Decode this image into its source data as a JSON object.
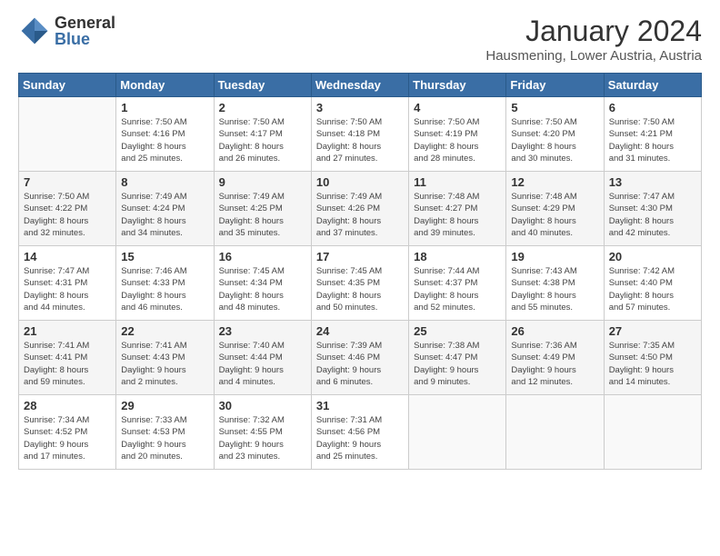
{
  "logo": {
    "general": "General",
    "blue": "Blue"
  },
  "title": "January 2024",
  "subtitle": "Hausmening, Lower Austria, Austria",
  "days_header": [
    "Sunday",
    "Monday",
    "Tuesday",
    "Wednesday",
    "Thursday",
    "Friday",
    "Saturday"
  ],
  "weeks": [
    [
      {
        "day": "",
        "info": ""
      },
      {
        "day": "1",
        "info": "Sunrise: 7:50 AM\nSunset: 4:16 PM\nDaylight: 8 hours\nand 25 minutes."
      },
      {
        "day": "2",
        "info": "Sunrise: 7:50 AM\nSunset: 4:17 PM\nDaylight: 8 hours\nand 26 minutes."
      },
      {
        "day": "3",
        "info": "Sunrise: 7:50 AM\nSunset: 4:18 PM\nDaylight: 8 hours\nand 27 minutes."
      },
      {
        "day": "4",
        "info": "Sunrise: 7:50 AM\nSunset: 4:19 PM\nDaylight: 8 hours\nand 28 minutes."
      },
      {
        "day": "5",
        "info": "Sunrise: 7:50 AM\nSunset: 4:20 PM\nDaylight: 8 hours\nand 30 minutes."
      },
      {
        "day": "6",
        "info": "Sunrise: 7:50 AM\nSunset: 4:21 PM\nDaylight: 8 hours\nand 31 minutes."
      }
    ],
    [
      {
        "day": "7",
        "info": "Sunrise: 7:50 AM\nSunset: 4:22 PM\nDaylight: 8 hours\nand 32 minutes."
      },
      {
        "day": "8",
        "info": "Sunrise: 7:49 AM\nSunset: 4:24 PM\nDaylight: 8 hours\nand 34 minutes."
      },
      {
        "day": "9",
        "info": "Sunrise: 7:49 AM\nSunset: 4:25 PM\nDaylight: 8 hours\nand 35 minutes."
      },
      {
        "day": "10",
        "info": "Sunrise: 7:49 AM\nSunset: 4:26 PM\nDaylight: 8 hours\nand 37 minutes."
      },
      {
        "day": "11",
        "info": "Sunrise: 7:48 AM\nSunset: 4:27 PM\nDaylight: 8 hours\nand 39 minutes."
      },
      {
        "day": "12",
        "info": "Sunrise: 7:48 AM\nSunset: 4:29 PM\nDaylight: 8 hours\nand 40 minutes."
      },
      {
        "day": "13",
        "info": "Sunrise: 7:47 AM\nSunset: 4:30 PM\nDaylight: 8 hours\nand 42 minutes."
      }
    ],
    [
      {
        "day": "14",
        "info": "Sunrise: 7:47 AM\nSunset: 4:31 PM\nDaylight: 8 hours\nand 44 minutes."
      },
      {
        "day": "15",
        "info": "Sunrise: 7:46 AM\nSunset: 4:33 PM\nDaylight: 8 hours\nand 46 minutes."
      },
      {
        "day": "16",
        "info": "Sunrise: 7:45 AM\nSunset: 4:34 PM\nDaylight: 8 hours\nand 48 minutes."
      },
      {
        "day": "17",
        "info": "Sunrise: 7:45 AM\nSunset: 4:35 PM\nDaylight: 8 hours\nand 50 minutes."
      },
      {
        "day": "18",
        "info": "Sunrise: 7:44 AM\nSunset: 4:37 PM\nDaylight: 8 hours\nand 52 minutes."
      },
      {
        "day": "19",
        "info": "Sunrise: 7:43 AM\nSunset: 4:38 PM\nDaylight: 8 hours\nand 55 minutes."
      },
      {
        "day": "20",
        "info": "Sunrise: 7:42 AM\nSunset: 4:40 PM\nDaylight: 8 hours\nand 57 minutes."
      }
    ],
    [
      {
        "day": "21",
        "info": "Sunrise: 7:41 AM\nSunset: 4:41 PM\nDaylight: 8 hours\nand 59 minutes."
      },
      {
        "day": "22",
        "info": "Sunrise: 7:41 AM\nSunset: 4:43 PM\nDaylight: 9 hours\nand 2 minutes."
      },
      {
        "day": "23",
        "info": "Sunrise: 7:40 AM\nSunset: 4:44 PM\nDaylight: 9 hours\nand 4 minutes."
      },
      {
        "day": "24",
        "info": "Sunrise: 7:39 AM\nSunset: 4:46 PM\nDaylight: 9 hours\nand 6 minutes."
      },
      {
        "day": "25",
        "info": "Sunrise: 7:38 AM\nSunset: 4:47 PM\nDaylight: 9 hours\nand 9 minutes."
      },
      {
        "day": "26",
        "info": "Sunrise: 7:36 AM\nSunset: 4:49 PM\nDaylight: 9 hours\nand 12 minutes."
      },
      {
        "day": "27",
        "info": "Sunrise: 7:35 AM\nSunset: 4:50 PM\nDaylight: 9 hours\nand 14 minutes."
      }
    ],
    [
      {
        "day": "28",
        "info": "Sunrise: 7:34 AM\nSunset: 4:52 PM\nDaylight: 9 hours\nand 17 minutes."
      },
      {
        "day": "29",
        "info": "Sunrise: 7:33 AM\nSunset: 4:53 PM\nDaylight: 9 hours\nand 20 minutes."
      },
      {
        "day": "30",
        "info": "Sunrise: 7:32 AM\nSunset: 4:55 PM\nDaylight: 9 hours\nand 23 minutes."
      },
      {
        "day": "31",
        "info": "Sunrise: 7:31 AM\nSunset: 4:56 PM\nDaylight: 9 hours\nand 25 minutes."
      },
      {
        "day": "",
        "info": ""
      },
      {
        "day": "",
        "info": ""
      },
      {
        "day": "",
        "info": ""
      }
    ]
  ]
}
